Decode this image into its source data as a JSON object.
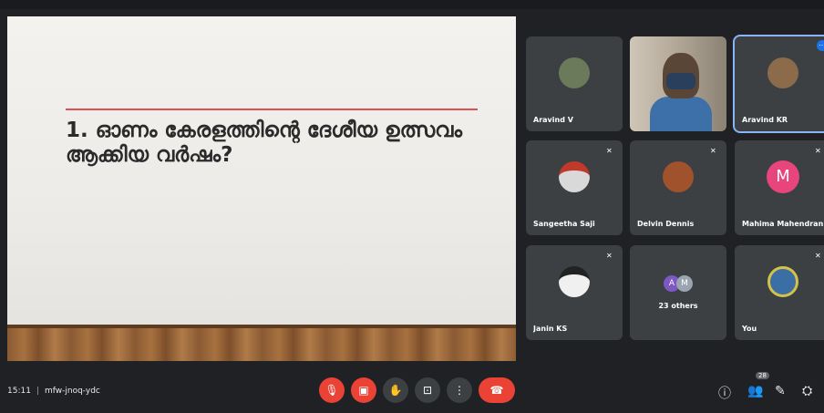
{
  "slide": {
    "line1": "1. ഓണം കേരളത്തിന്റെ ദേശീയ ഉത്സവം",
    "line2": "ആക്കിയ വർഷം?"
  },
  "participants": [
    {
      "name": "Aravind V",
      "muted": false
    },
    {
      "name": "",
      "muted": false,
      "video": true
    },
    {
      "name": "Aravind KR",
      "muted": false,
      "active": true
    },
    {
      "name": "Sangeetha Saji",
      "muted": true
    },
    {
      "name": "Delvin Dennis",
      "muted": true
    },
    {
      "name": "Mahima Mahendran",
      "muted": true,
      "initial": "M"
    },
    {
      "name": "Janin KS",
      "muted": true
    },
    {
      "name": "23 others",
      "muted": false,
      "initials": [
        "A",
        "M"
      ]
    },
    {
      "name": "You",
      "muted": true
    }
  ],
  "bottom_bar": {
    "time": "15:11",
    "meeting_code": "mfw-jnoq-ydc",
    "people_count": "28"
  },
  "icons": {
    "mic": "mic-off-icon",
    "camera": "camera-off-icon",
    "raise_hand": "hand-icon",
    "present": "present-icon",
    "more": "more-vert-icon",
    "hangup": "phone-hangup-icon",
    "info": "info-icon",
    "people": "people-icon",
    "chat": "chat-icon",
    "activities": "activities-icon"
  },
  "colors": {
    "accent_red": "#ea4335",
    "tile_bg": "#3c4043",
    "page_bg": "#202124",
    "mahima_avatar": "#e8457c"
  }
}
